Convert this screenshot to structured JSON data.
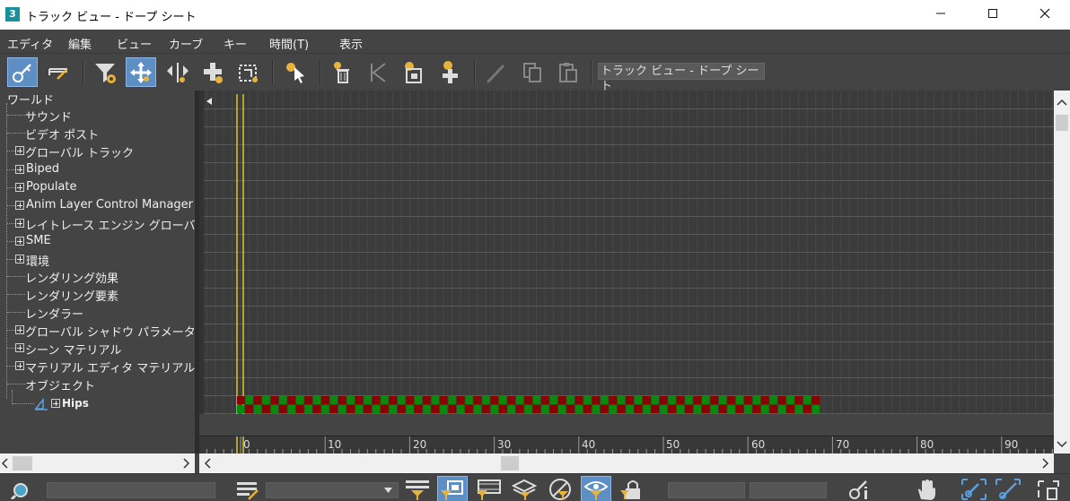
{
  "window": {
    "title": "トラック ビュー - ドープ シート",
    "app_icon_text": "3",
    "minimize": "—",
    "maximize": "☐",
    "close": "✕"
  },
  "menu": [
    {
      "label": "エディタ"
    },
    {
      "label": "編集"
    },
    {
      "label": "ビュー"
    },
    {
      "label": "カーブ"
    },
    {
      "label": "キー"
    },
    {
      "label": "時間(T)"
    },
    {
      "label": "表示"
    }
  ],
  "toolbar": {
    "trackview_name": "トラック ビュー - ドープ シート",
    "buttons": [
      {
        "icon": "edit-keys-icon",
        "active": true
      },
      {
        "icon": "edit-ranges-icon",
        "active": false
      },
      {
        "icon": "filter-icon",
        "active": false
      },
      {
        "icon": "move-keys-icon",
        "active": true
      },
      {
        "icon": "slide-keys-icon",
        "active": false
      },
      {
        "icon": "add-keys-icon",
        "active": false
      },
      {
        "icon": "scale-keys-icon",
        "active": false
      },
      {
        "icon": "select-time-icon",
        "active": false
      },
      {
        "icon": "delete-time-icon",
        "active": false
      },
      {
        "icon": "reverse-time-icon",
        "active": false
      },
      {
        "icon": "scale-time-icon",
        "active": false
      },
      {
        "icon": "insert-time-icon",
        "active": false
      },
      {
        "icon": "modify-subtree-icon",
        "active": false
      },
      {
        "icon": "copy-icon",
        "active": false
      },
      {
        "icon": "paste-icon",
        "active": false
      }
    ]
  },
  "tree": {
    "root": "ワールド",
    "items": [
      {
        "label": "サウンド",
        "expandable": false
      },
      {
        "label": "ビデオ ポスト",
        "expandable": false
      },
      {
        "label": "グローバル トラック",
        "expandable": true
      },
      {
        "label": "Biped",
        "expandable": true
      },
      {
        "label": "Populate",
        "expandable": true
      },
      {
        "label": "Anim Layer Control Manager",
        "expandable": true
      },
      {
        "label": "レイトレース エンジン グローバル",
        "expandable": true
      },
      {
        "label": "SME",
        "expandable": true
      },
      {
        "label": "環境",
        "expandable": true
      },
      {
        "label": "レンダリング効果",
        "expandable": false
      },
      {
        "label": "レンダリング要素",
        "expandable": false
      },
      {
        "label": "レンダラー",
        "expandable": false
      },
      {
        "label": "グローバル シャドウ パラメータ",
        "expandable": true
      },
      {
        "label": "シーン マテリアル",
        "expandable": true
      },
      {
        "label": "マテリアル エディタ マテリアル",
        "expandable": true
      },
      {
        "label": "オブジェクト",
        "expandable": false
      }
    ],
    "child": {
      "label": "Hips",
      "icon": "bone-icon"
    }
  },
  "timeline": {
    "ruler_labels": [
      "0",
      "10",
      "20",
      "30",
      "40",
      "50",
      "60",
      "70",
      "80",
      "90"
    ],
    "key_frames_start": 0,
    "key_frames_end": 68,
    "key_colors": {
      "red": "#8b0000",
      "green": "#0a8a0a"
    }
  },
  "colors": {
    "accent": "#5d8fc5",
    "time_slider": "#d9c82b"
  }
}
